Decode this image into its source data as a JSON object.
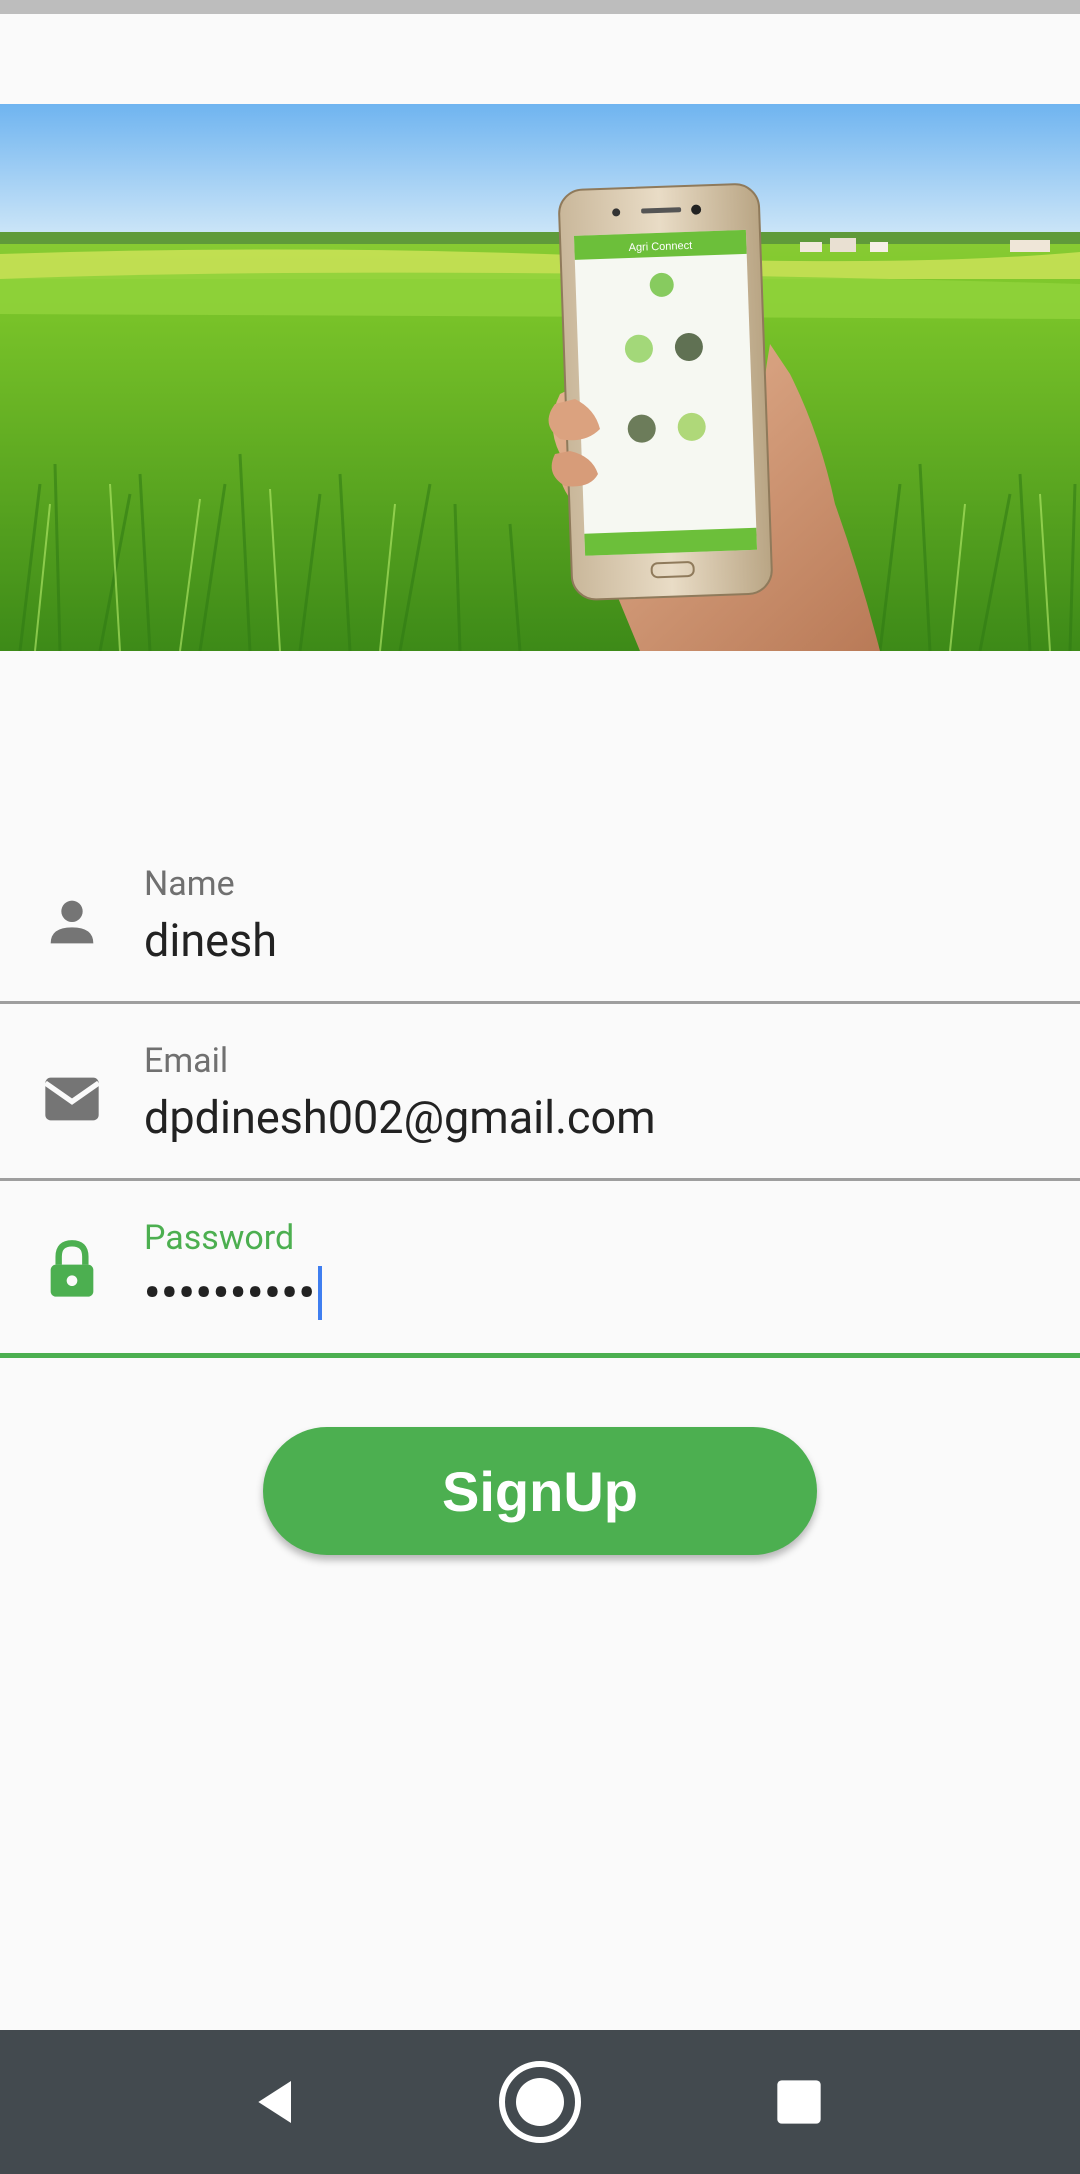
{
  "form": {
    "name": {
      "label": "Name",
      "value": "dinesh"
    },
    "email": {
      "label": "Email",
      "value": "dpdinesh002@gmail.com"
    },
    "password": {
      "label": "Password",
      "value": "••••••••••"
    }
  },
  "signup_button": {
    "label": "SignUp"
  },
  "colors": {
    "accent": "#4caf50",
    "nav_bar": "#434a4f",
    "caret": "#3f7ef0"
  },
  "icons": {
    "name": "person-icon",
    "email": "mail-icon",
    "password": "lock-icon",
    "nav_back": "back-triangle-icon",
    "nav_home": "home-circle-icon",
    "nav_recents": "recents-square-icon"
  }
}
